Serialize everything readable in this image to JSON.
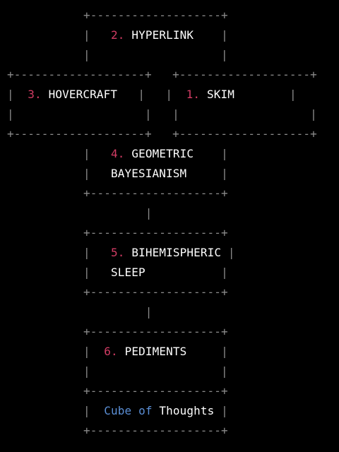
{
  "colors": {
    "background": "#000000",
    "border": "#8a8a8a",
    "text": "#ffffff",
    "number": "#d23c64",
    "brand": "#5b8fd6"
  },
  "boxes": {
    "hyperlink": {
      "number": "2.",
      "line1": "HYPERLINK"
    },
    "hovercraft": {
      "number": "3.",
      "line1": "HOVERCRAFT"
    },
    "skim": {
      "number": "1.",
      "line1": "SKIM"
    },
    "geometric": {
      "number": "4.",
      "line1": "GEOMETRIC",
      "line2": "BAYESIANISM"
    },
    "bihemispheric": {
      "number": "5.",
      "line1": "BIHEMISPHERIC",
      "line2": "SLEEP"
    },
    "pediments": {
      "number": "6.",
      "line1": "PEDIMENTS"
    }
  },
  "footer": {
    "word1": "Cube",
    "word2": "of",
    "word3": "Thoughts"
  }
}
